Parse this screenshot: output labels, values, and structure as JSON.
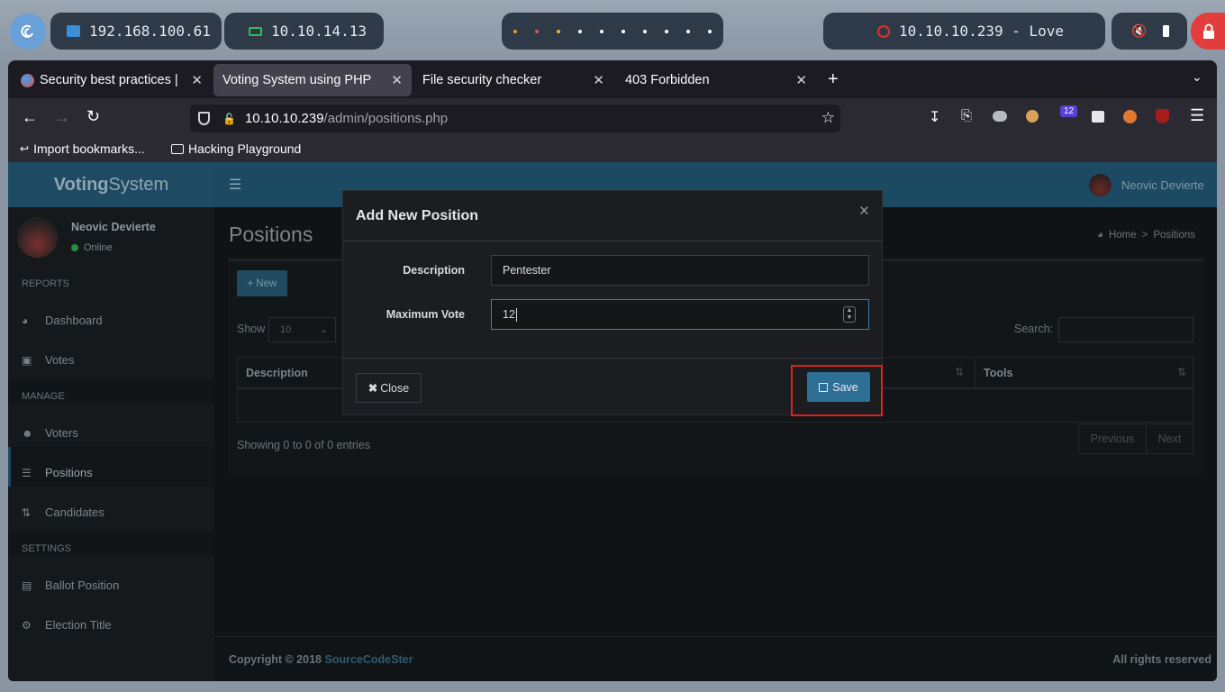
{
  "os_bar": {
    "ip_local": "192.168.100.61",
    "ip_vpn": "10.10.14.13",
    "target": "10.10.10.239 - Love"
  },
  "browser": {
    "tabs": [
      {
        "label": "Security best practices |"
      },
      {
        "label": "Voting System using PHP"
      },
      {
        "label": "File security checker"
      },
      {
        "label": "403 Forbidden"
      }
    ],
    "url_host": "10.10.10.239",
    "url_path": "/admin/positions.php",
    "badge_count": "12",
    "bookmarks": [
      "Import bookmarks...",
      "Hacking Playground"
    ]
  },
  "app": {
    "logo_bold": "Voting",
    "logo_rest": "System",
    "user_name": "Neovic Devierte",
    "status": "Online",
    "sidebar": [
      {
        "type": "section",
        "label": "REPORTS"
      },
      {
        "type": "item",
        "label": "Dashboard",
        "icon": "dashboard-icon"
      },
      {
        "type": "item",
        "label": "Votes",
        "icon": "lock-icon"
      },
      {
        "type": "section",
        "label": "MANAGE"
      },
      {
        "type": "item",
        "label": "Voters",
        "icon": "users-icon"
      },
      {
        "type": "item",
        "label": "Positions",
        "icon": "list-icon"
      },
      {
        "type": "item",
        "label": "Candidates",
        "icon": "sort-icon"
      },
      {
        "type": "section",
        "label": "SETTINGS"
      },
      {
        "type": "item",
        "label": "Ballot Position",
        "icon": "file-icon"
      },
      {
        "type": "item",
        "label": "Election Title",
        "icon": "gear-icon"
      }
    ],
    "page_title": "Positions",
    "breadcrumb_home": "Home",
    "breadcrumb_sep": ">",
    "breadcrumb_current": "Positions",
    "new_button": "New",
    "show_label": "Show",
    "show_value": "10",
    "search_label": "Search:",
    "col_description": "Description",
    "col_tools": "Tools",
    "info": "Showing 0 to 0 of 0 entries",
    "prev": "Previous",
    "next": "Next",
    "footer_copy": "Copyright © 2018",
    "footer_link": "SourceCodeSter",
    "footer_right": "All rights reserved"
  },
  "modal": {
    "title": "Add New Position",
    "close_x": "×",
    "description_label": "Description",
    "description_value": "Pentester",
    "max_vote_label": "Maximum Vote",
    "max_vote_value": "12",
    "close_button": "Close",
    "save_button": "Save"
  },
  "colors": {
    "header_blue": "#1c4a63",
    "save_blue": "#2e6f96",
    "highlight_red": "#e02020"
  }
}
